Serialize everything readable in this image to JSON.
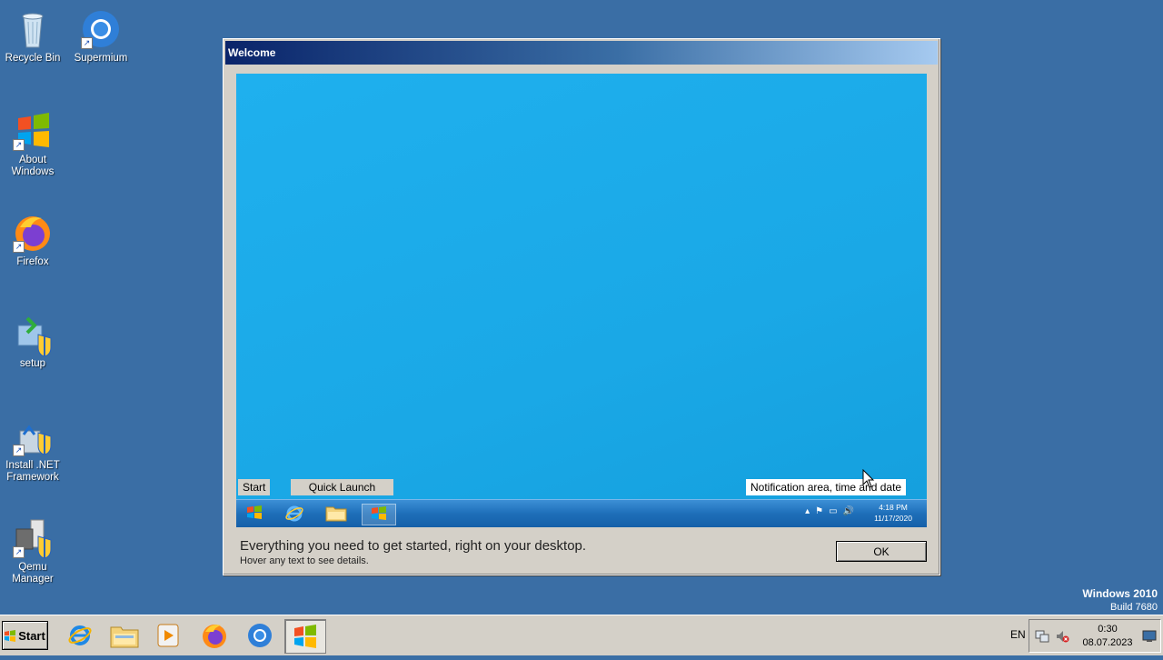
{
  "desktop": {
    "icons": [
      {
        "label": "Recycle Bin",
        "icon": "recycle-bin-icon"
      },
      {
        "label": "Supermium",
        "icon": "supermium-icon"
      },
      {
        "label": "About Windows",
        "icon": "windows-flag-icon"
      },
      {
        "label": "Firefox",
        "icon": "firefox-icon"
      },
      {
        "label": "setup",
        "icon": "setup-icon"
      },
      {
        "label": "Install .NET Framework",
        "icon": "dotnet-installer-icon"
      },
      {
        "label": "Qemu Manager",
        "icon": "qemu-manager-icon"
      }
    ],
    "watermark": {
      "title": "Windows 2010",
      "build": "Build 7680"
    }
  },
  "dialog": {
    "title": "Welcome",
    "preview": {
      "start_tag": "Start",
      "quick_launch_tag": "Quick Launch",
      "notification_tag": "Notification area, time and date",
      "time": "4:18 PM",
      "date": "11/17/2020"
    },
    "main_text": "Everything you need to get started, right on your desktop.",
    "sub_text": "Hover any text to see details.",
    "ok_label": "OK"
  },
  "taskbar": {
    "start_label": "Start",
    "language": "EN",
    "time": "0:30",
    "date": "08.07.2023",
    "pinned": [
      "internet-explorer-icon",
      "file-explorer-icon",
      "media-player-icon",
      "firefox-icon",
      "supermium-icon",
      "welcome-window-icon"
    ]
  }
}
